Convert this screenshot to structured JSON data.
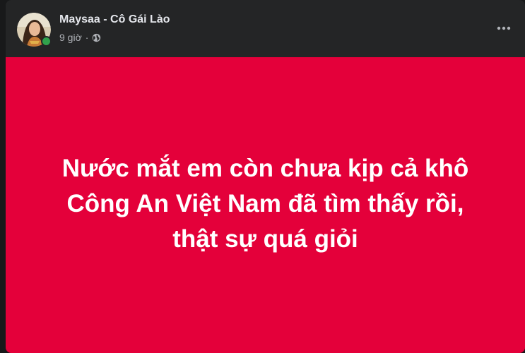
{
  "post": {
    "author": "Maysaa - Cô Gái Lào",
    "time": "9 giờ",
    "separator": "·",
    "privacy_icon": "globe-icon",
    "more_icon": "more-horizontal-icon",
    "author_online": true,
    "background_color": "#e4003a",
    "text_lines": [
      "Nước mắt em còn chưa kịp cả khô",
      "Công An Việt Nam đã tìm thấy rồi,",
      "thật sự quá giỏi"
    ]
  }
}
